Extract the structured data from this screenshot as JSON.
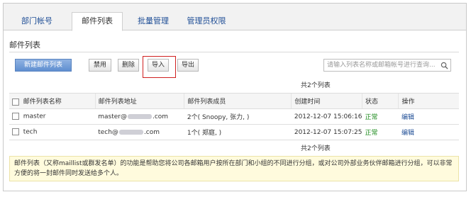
{
  "tabs": [
    {
      "label": "部门帐号"
    },
    {
      "label": "邮件列表"
    },
    {
      "label": "批量管理"
    },
    {
      "label": "管理员权限"
    }
  ],
  "section_title": "邮件列表",
  "toolbar": {
    "create_label": "新建邮件列表",
    "disable_label": "禁用",
    "delete_label": "删除",
    "import_label": "导入",
    "export_label": "导出"
  },
  "search": {
    "placeholder": "请输入列表名称或邮箱帐号进行查询..."
  },
  "count_text": "共2个列表",
  "table": {
    "headers": [
      "邮件列表名称",
      "邮件列表地址",
      "邮件列表成员",
      "创建时间",
      "状态",
      "操作"
    ],
    "rows": [
      {
        "name": "master",
        "addr_user": "master@",
        "addr_tld": ".com",
        "members": "2个( Snoopy, 张力, )",
        "created": "2012-12-07 15:06:16",
        "status": "正常",
        "action": "编辑"
      },
      {
        "name": "tech",
        "addr_user": "tech@",
        "addr_tld": ".com",
        "members": "1个( 郑庭, )",
        "created": "2012-12-07 15:07:25",
        "status": "正常",
        "action": "编辑"
      }
    ]
  },
  "notice": "邮件列表（又称maillist或群发名单）的功能是帮助您将公司各邮箱用户按所在部门和小组的不同进行分组，或对公司外部业务伙伴邮箱进行分组，可以非常方便的将一封邮件同时发送给多个人。",
  "colors": {
    "primary": "#6a96d4",
    "link": "#1f4e96",
    "ok": "#1c8a1c",
    "highlight": "#d02020",
    "notice_bg": "#fffbdd"
  }
}
